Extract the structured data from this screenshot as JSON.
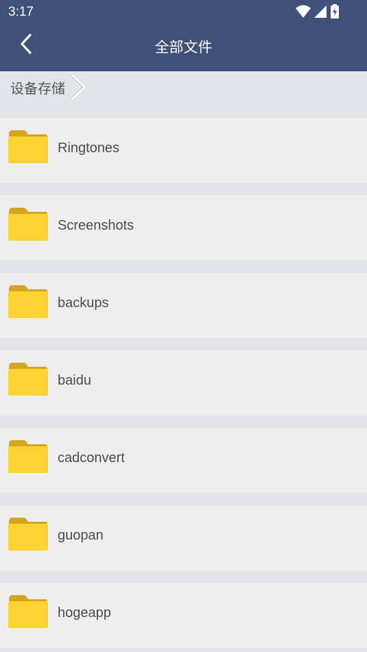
{
  "status_bar": {
    "time": "3:17",
    "icons": [
      "wifi-icon",
      "signal-icon",
      "battery-icon"
    ]
  },
  "header": {
    "title": "全部文件",
    "back_icon": "chevron-left-icon",
    "background_color": "#3f5178"
  },
  "breadcrumb": {
    "label": "设备存储",
    "separator_icon": "chevron-right-icon"
  },
  "folders": [
    {
      "name": "Ringtones"
    },
    {
      "name": "Screenshots"
    },
    {
      "name": "backups"
    },
    {
      "name": "baidu"
    },
    {
      "name": "cadconvert"
    },
    {
      "name": "guopan"
    },
    {
      "name": "hogeapp"
    }
  ],
  "colors": {
    "folder_front": "#fdd233",
    "folder_back": "#d4a520",
    "row_background": "#eeeeee",
    "separator": "#e3e4e8"
  }
}
